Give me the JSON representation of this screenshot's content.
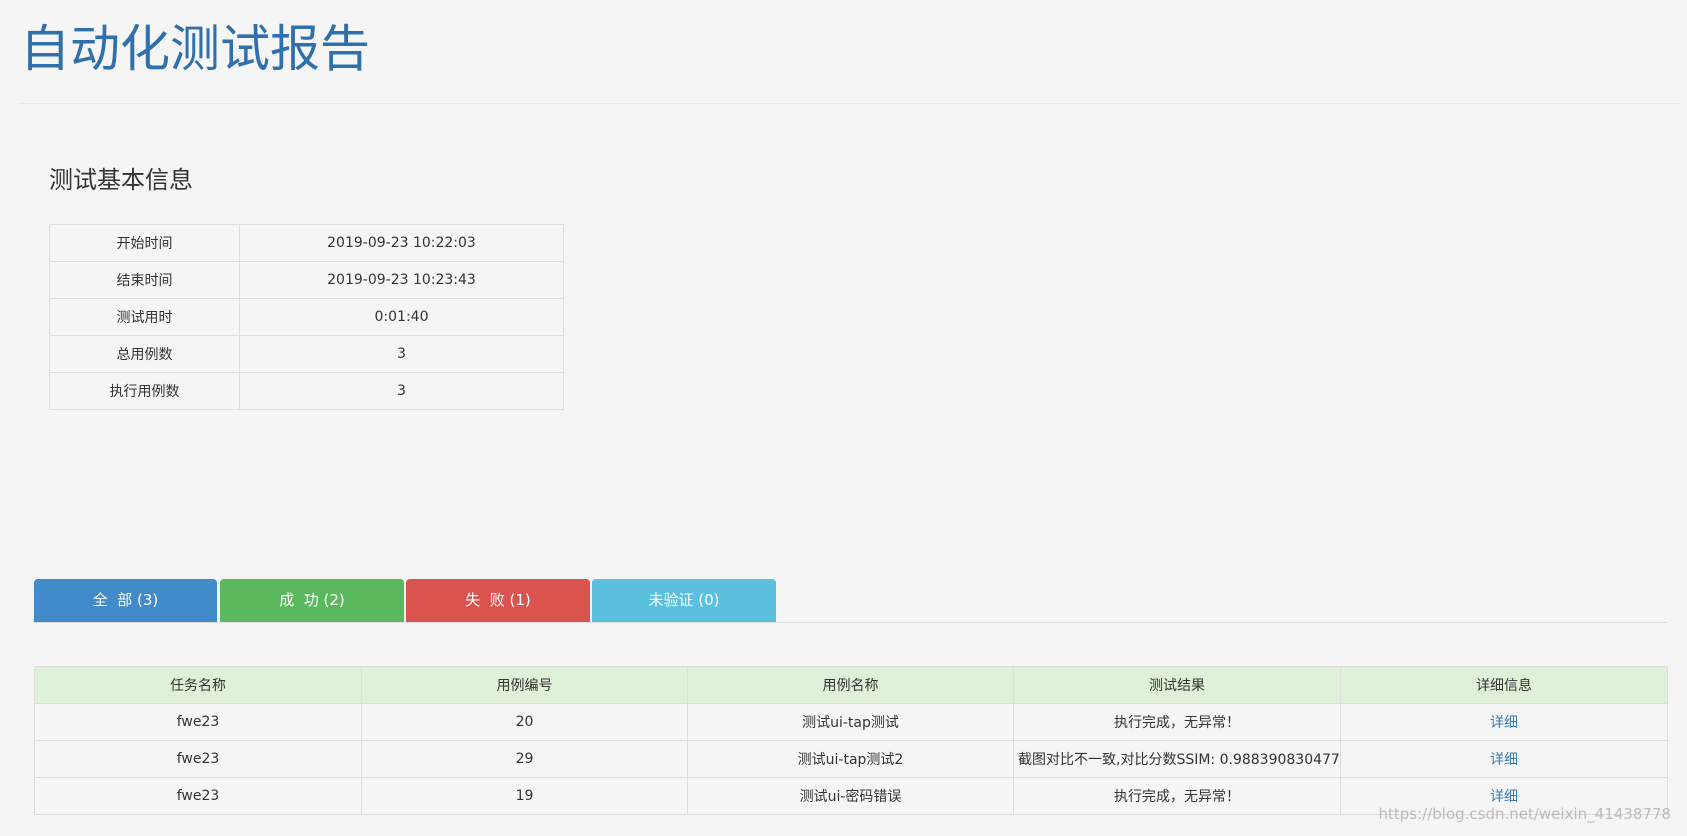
{
  "header": {
    "title": "自动化测试报告"
  },
  "basic_info": {
    "section_title": "测试基本信息",
    "rows": [
      {
        "label": "开始时间",
        "value": "2019-09-23 10:22:03"
      },
      {
        "label": "结束时间",
        "value": "2019-09-23 10:23:43"
      },
      {
        "label": "测试用时",
        "value": "0:01:40"
      },
      {
        "label": "总用例数",
        "value": "3"
      },
      {
        "label": "执行用例数",
        "value": "3"
      }
    ]
  },
  "tabs": [
    {
      "label": "全  部 (3)",
      "color": "#428bca"
    },
    {
      "label": "成  功 (2)",
      "color": "#5cb85c"
    },
    {
      "label": "失  败 (1)",
      "color": "#d9534f"
    },
    {
      "label": "未验证 (0)",
      "color": "#5bc0de"
    }
  ],
  "results": {
    "columns": [
      "任务名称",
      "用例编号",
      "用例名称",
      "测试结果",
      "详细信息"
    ],
    "rows": [
      {
        "task": "fwe23",
        "case_id": "20",
        "case_name": "测试ui-tap测试",
        "result": "执行完成，无异常！",
        "detail": "详细"
      },
      {
        "task": "fwe23",
        "case_id": "29",
        "case_name": "测试ui-tap测试2",
        "result": "截图对比不一致,对比分数SSIM: 0.988390830477",
        "detail": "详细"
      },
      {
        "task": "fwe23",
        "case_id": "19",
        "case_name": "测试ui-密码错误",
        "result": "执行完成，无异常！",
        "detail": "详细"
      }
    ]
  },
  "watermark": "https://blog.csdn.net/weixin_41438778"
}
